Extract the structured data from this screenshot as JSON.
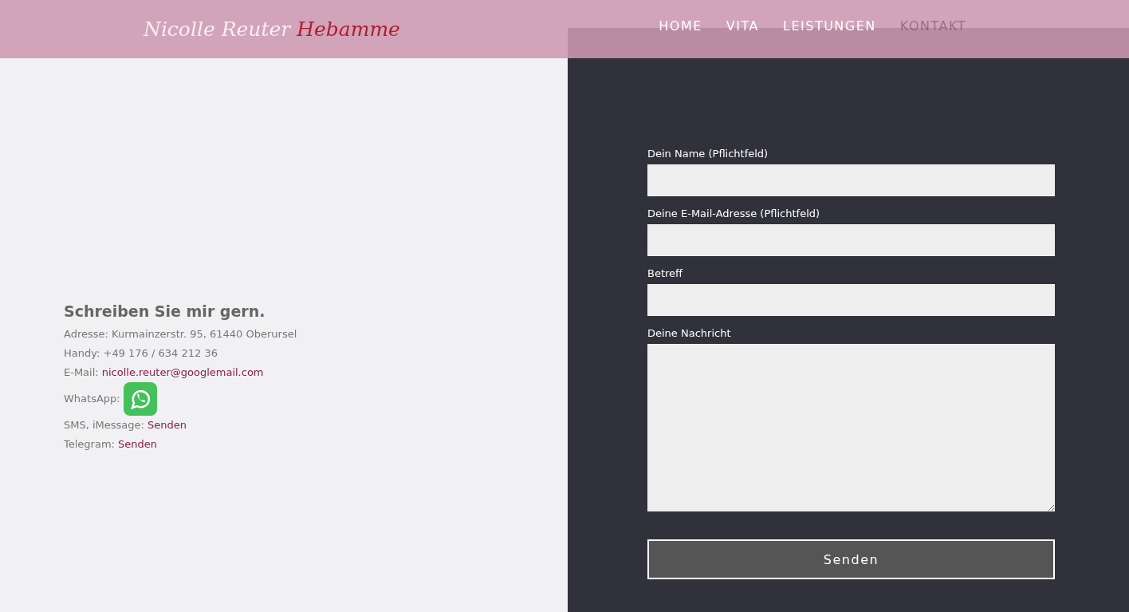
{
  "header": {
    "logo": {
      "name": "Nicolle Reuter",
      "title": "Hebamme"
    },
    "nav": [
      {
        "label": "HOME",
        "selected": false
      },
      {
        "label": "VITA",
        "selected": false
      },
      {
        "label": "LEISTUNGEN",
        "selected": false
      },
      {
        "label": "KONTAKT",
        "selected": true
      }
    ]
  },
  "contact": {
    "heading": "Schreiben Sie mir gern.",
    "lines": [
      {
        "kind": "text",
        "label": "Adresse: Kurmainzerstr. 95, 61440 Oberursel"
      },
      {
        "kind": "text",
        "label": "Handy: +49 176 / 634 212 36"
      },
      {
        "kind": "link",
        "label": "E-Mail:",
        "link": "nicolle.reuter@googlemail.com"
      },
      {
        "kind": "icon",
        "label": "WhatsApp:"
      },
      {
        "kind": "link",
        "label": "SMS, iMessage:",
        "link": "Senden"
      },
      {
        "kind": "link",
        "label": "Telegram:",
        "link": "Senden"
      }
    ]
  },
  "form": {
    "fields": [
      {
        "kind": "input",
        "label": "Dein Name (Pflichtfeld)"
      },
      {
        "kind": "input",
        "label": "Deine E-Mail-Adresse (Pflichtfeld)"
      },
      {
        "kind": "input",
        "label": "Betreff"
      },
      {
        "kind": "textarea",
        "label": "Deine Nachricht"
      }
    ],
    "submit": "Senden"
  }
}
